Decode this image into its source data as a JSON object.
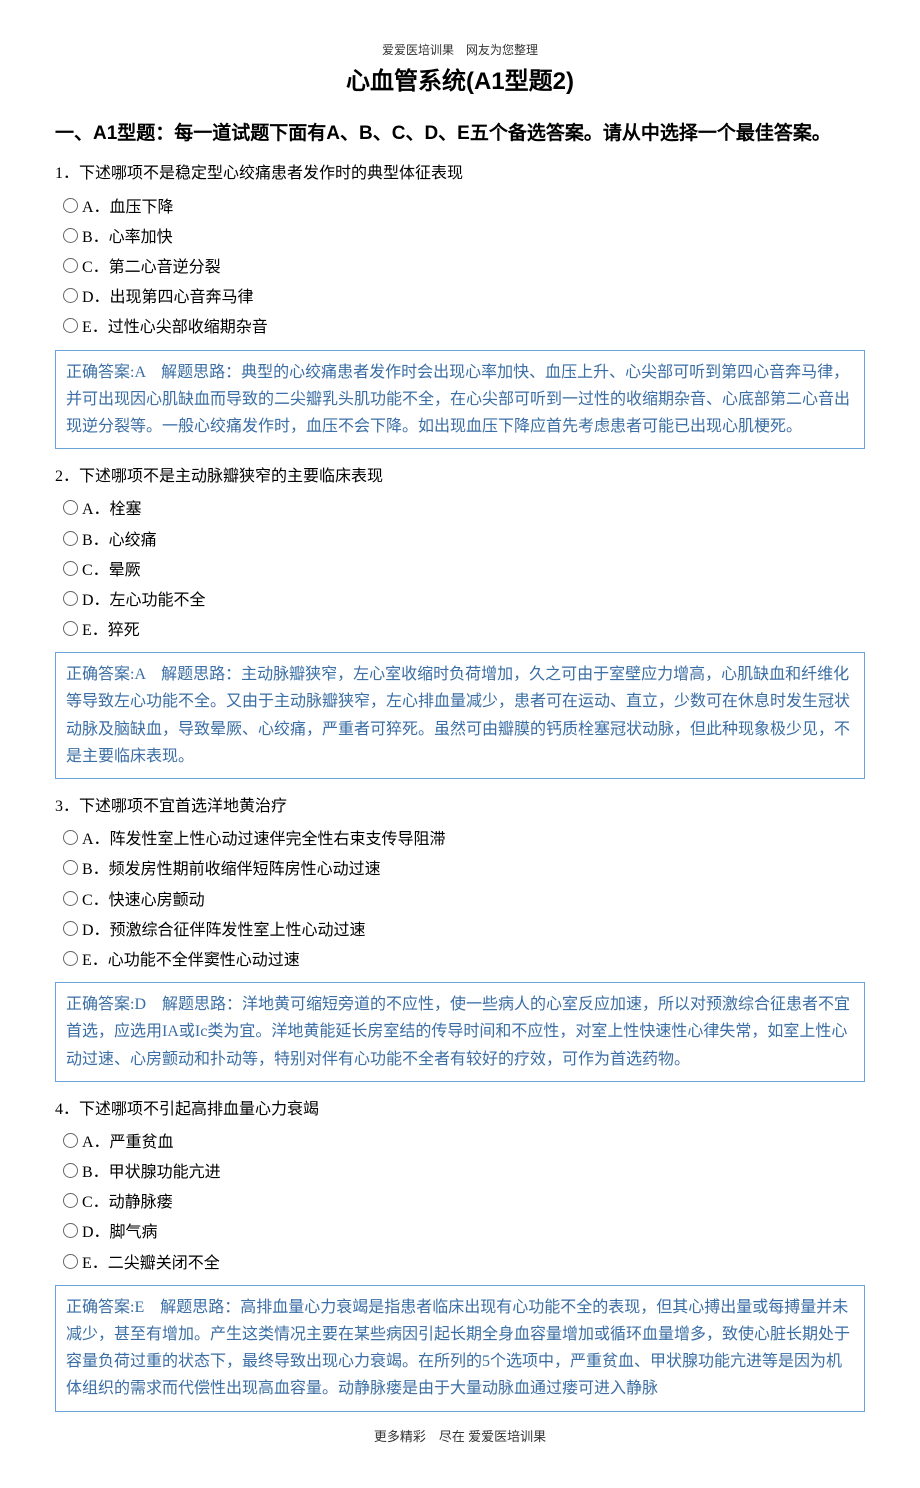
{
  "header": {
    "top_note": "爱爱医培训果　网友为您整理",
    "main_title": "心血管系统(A1型题2)"
  },
  "section_title": "一、A1型题：每一道试题下面有A、B、C、D、E五个备选答案。请从中选择一个最佳答案。",
  "questions": [
    {
      "stem": "1．下述哪项不是稳定型心绞痛患者发作时的典型体征表现",
      "options": [
        "A．血压下降",
        "B．心率加快",
        "C．第二心音逆分裂",
        "D．出现第四心音奔马律",
        "E．过性心尖部收缩期杂音"
      ],
      "answer": "正确答案:A　解题思路：典型的心绞痛患者发作时会出现心率加快、血压上升、心尖部可听到第四心音奔马律，并可出现因心肌缺血而导致的二尖瓣乳头肌功能不全，在心尖部可听到一过性的收缩期杂音、心底部第二心音出现逆分裂等。一般心绞痛发作时，血压不会下降。如出现血压下降应首先考虑患者可能已出现心肌梗死。"
    },
    {
      "stem": "2．下述哪项不是主动脉瓣狭窄的主要临床表现",
      "options": [
        "A．栓塞",
        "B．心绞痛",
        "C．晕厥",
        "D．左心功能不全",
        "E．猝死"
      ],
      "answer": "正确答案:A　解题思路：主动脉瓣狭窄，左心室收缩时负荷增加，久之可由于室壁应力增高，心肌缺血和纤维化等导致左心功能不全。又由于主动脉瓣狭窄，左心排血量减少，患者可在运动、直立，少数可在休息时发生冠状动脉及脑缺血，导致晕厥、心绞痛，严重者可猝死。虽然可由瓣膜的钙质栓塞冠状动脉，但此种现象极少见，不是主要临床表现。"
    },
    {
      "stem": "3．下述哪项不宜首选洋地黄治疗",
      "options": [
        "A．阵发性室上性心动过速伴完全性右束支传导阻滞",
        "B．频发房性期前收缩伴短阵房性心动过速",
        "C．快速心房颤动",
        "D．预激综合征伴阵发性室上性心动过速",
        "E．心功能不全伴窦性心动过速"
      ],
      "answer": "正确答案:D　解题思路：洋地黄可缩短旁道的不应性，使一些病人的心室反应加速，所以对预激综合征患者不宜首选，应选用IA或Ic类为宜。洋地黄能延长房室结的传导时间和不应性，对室上性快速性心律失常，如室上性心动过速、心房颤动和扑动等，特别对伴有心功能不全者有较好的疗效，可作为首选药物。"
    },
    {
      "stem": "4．下述哪项不引起高排血量心力衰竭",
      "options": [
        "A．严重贫血",
        "B．甲状腺功能亢进",
        "C．动静脉瘘",
        "D．脚气病",
        "E．二尖瓣关闭不全"
      ],
      "answer": "正确答案:E　解题思路：高排血量心力衰竭是指患者临床出现有心功能不全的表现，但其心搏出量或每搏量并未减少，甚至有增加。产生这类情况主要在某些病因引起长期全身血容量增加或循环血量增多，致使心脏长期处于容量负荷过重的状态下，最终导致出现心力衰竭。在所列的5个选项中，严重贫血、甲状腺功能亢进等是因为机体组织的需求而代偿性出现高血容量。动静脉瘘是由于大量动脉血通过瘘可进入静脉"
    }
  ],
  "footer": "更多精彩　尽在 爱爱医培训果"
}
